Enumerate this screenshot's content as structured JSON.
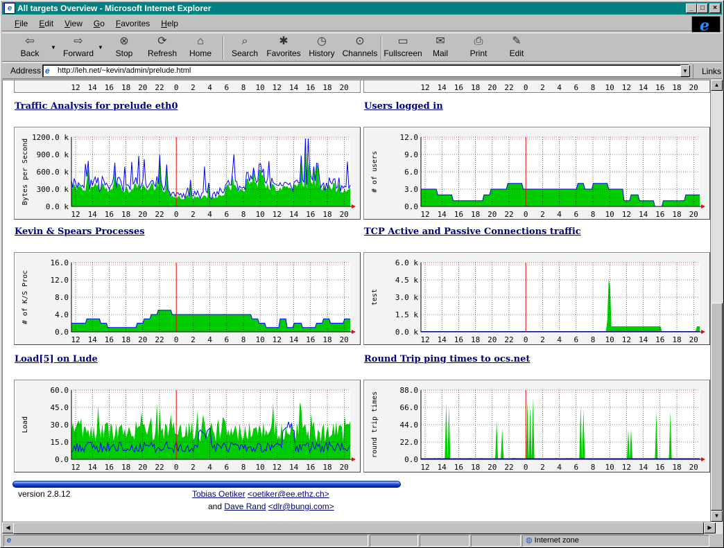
{
  "window": {
    "title": "All targets Overview - Microsoft Internet Explorer"
  },
  "menu": [
    "File",
    "Edit",
    "View",
    "Go",
    "Favorites",
    "Help"
  ],
  "toolbar": {
    "buttons": [
      {
        "label": "Back",
        "icon": "back-arrow-icon"
      },
      {
        "label": "Forward",
        "icon": "forward-arrow-icon"
      },
      {
        "label": "Stop",
        "icon": "stop-icon"
      },
      {
        "label": "Refresh",
        "icon": "refresh-icon"
      },
      {
        "label": "Home",
        "icon": "home-icon"
      },
      {
        "label": "Search",
        "icon": "search-icon"
      },
      {
        "label": "Favorites",
        "icon": "favorites-icon"
      },
      {
        "label": "History",
        "icon": "history-icon"
      },
      {
        "label": "Channels",
        "icon": "channels-icon"
      },
      {
        "label": "Fullscreen",
        "icon": "fullscreen-icon"
      },
      {
        "label": "Mail",
        "icon": "mail-icon"
      },
      {
        "label": "Print",
        "icon": "print-icon"
      },
      {
        "label": "Edit",
        "icon": "edit-icon"
      }
    ]
  },
  "address": {
    "label": "Address",
    "url": "http://leh.net/~kevin/admin/prelude.html",
    "links": "Links"
  },
  "status": {
    "zone": "Internet zone"
  },
  "xticks": [
    "12",
    "14",
    "16",
    "18",
    "20",
    "22",
    "0",
    "2",
    "4",
    "6",
    "8",
    "10",
    "12",
    "14",
    "16",
    "18",
    "20"
  ],
  "charts": [
    {
      "title": "Traffic Analysis for prelude eth0",
      "ylabel": "Bytes per Second",
      "yticks": [
        "1200.0 k",
        "900.0 k",
        "600.0 k",
        "300.0 k",
        "0.0 k"
      ],
      "ymax": 1200,
      "style": "traffic"
    },
    {
      "title": "Users logged in",
      "ylabel": "# of users",
      "yticks": [
        "12.0",
        "9.0",
        "6.0",
        "3.0",
        "0.0"
      ],
      "ymax": 12,
      "style": "users"
    },
    {
      "title": "Kevin & Spears Processes",
      "ylabel": "# of K/S Proc",
      "yticks": [
        "16.0",
        "12.0",
        "8.0",
        "4.0",
        "0.0"
      ],
      "ymax": 16,
      "style": "procs"
    },
    {
      "title": "TCP Active and Passive Connections traffic",
      "ylabel": "test",
      "yticks": [
        "6.0 k",
        "4.5 k",
        "3.0 k",
        "1.5 k",
        "0.0 k"
      ],
      "ymax": 6,
      "style": "tcp"
    },
    {
      "title": "Load[5] on Lude",
      "ylabel": "Load",
      "yticks": [
        "60.0",
        "45.0",
        "30.0",
        "15.0",
        "0.0"
      ],
      "ymax": 60,
      "style": "load"
    },
    {
      "title": "Round Trip ping times to ocs.net",
      "ylabel": "round trip times",
      "yticks": [
        "88.0",
        "66.0",
        "44.0",
        "22.0",
        "0.0"
      ],
      "ymax": 88,
      "style": "ping"
    }
  ],
  "footer": {
    "version": "version 2.8.12",
    "author1": "Tobias Oetiker",
    "email1": "<oetiker@ee.ethz.ch>",
    "and": "and",
    "author2": "Dave Rand",
    "email2": "<dlr@bungi.com>"
  }
}
